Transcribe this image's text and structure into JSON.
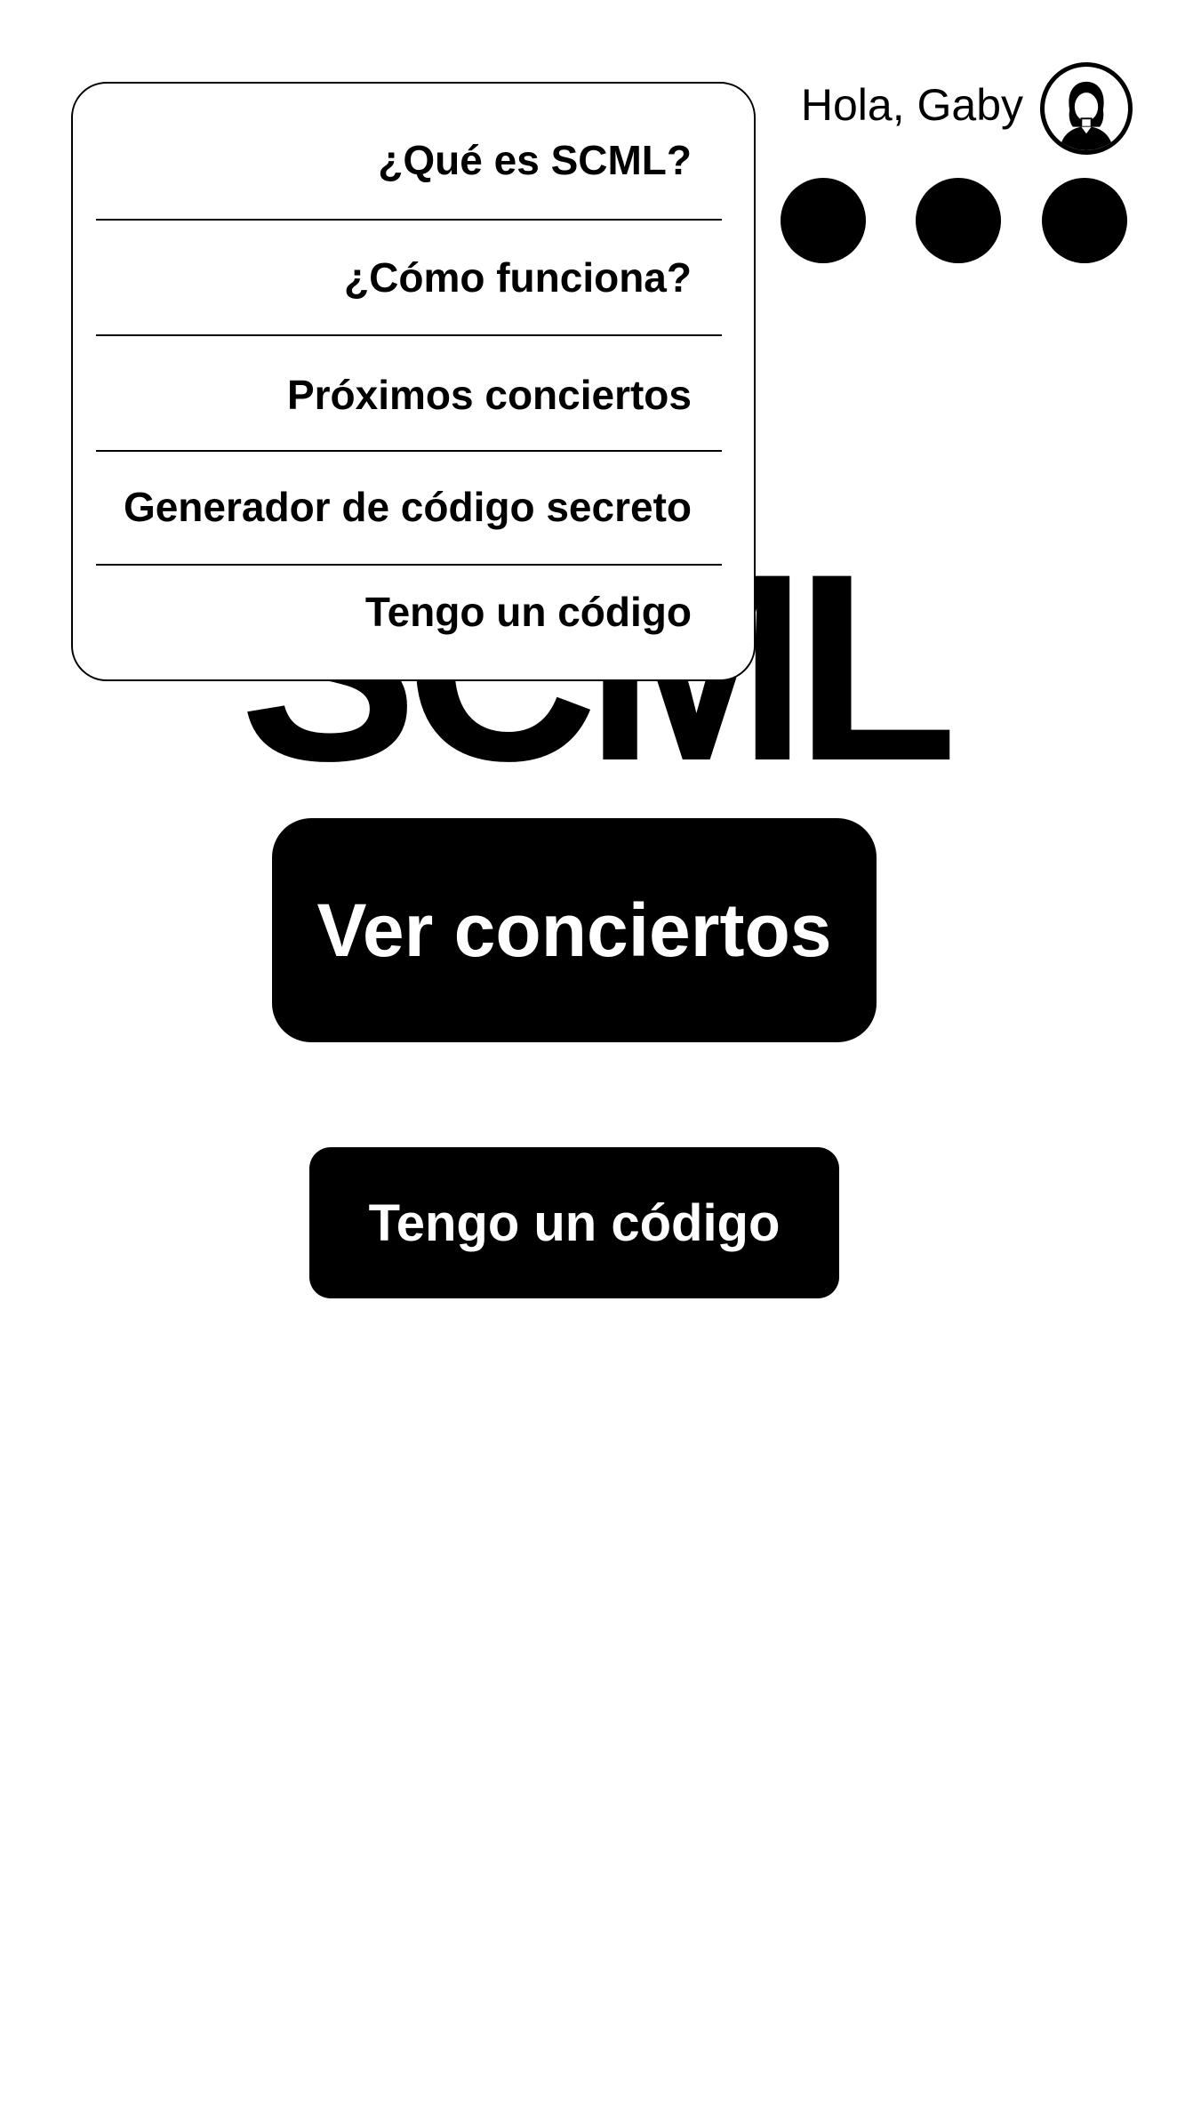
{
  "header": {
    "greeting": "Hola, Gaby",
    "avatar_icon": "user-avatar-icon"
  },
  "menu_indicator": {
    "icon": "three-dots-menu-icon",
    "dot_count": 3
  },
  "dropdown": {
    "items": [
      {
        "label": "¿Qué es SCML?"
      },
      {
        "label": "¿Cómo funciona?"
      },
      {
        "label": "Próximos conciertos"
      },
      {
        "label": "Generador de código secreto"
      },
      {
        "label": "Tengo un código"
      }
    ]
  },
  "hero": {
    "logo_text": "SCML"
  },
  "buttons": {
    "primary_label": "Ver conciertos",
    "secondary_label": "Tengo un código"
  },
  "colors": {
    "background": "#ffffff",
    "foreground": "#000000",
    "button_text": "#ffffff"
  }
}
